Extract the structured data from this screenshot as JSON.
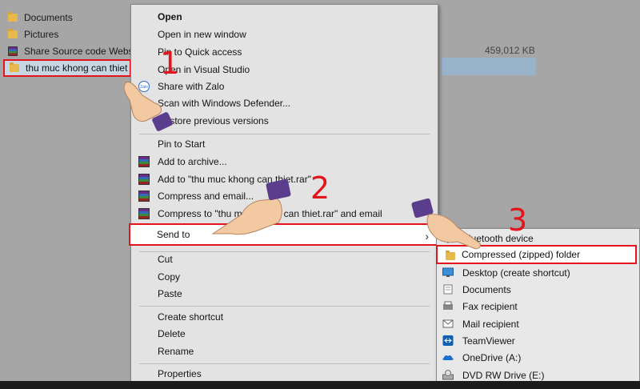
{
  "explorer": {
    "items": [
      {
        "name": "Documents",
        "icon": "folder-icon"
      },
      {
        "name": "Pictures",
        "icon": "folder-icon"
      },
      {
        "name": "Share Source code Websit",
        "icon": "rar-archive-icon"
      }
    ],
    "selected_item": "thu muc khong can thiet",
    "size_label": "459,012 KB"
  },
  "context_menu": {
    "open": "Open",
    "open_new_window": "Open in new window",
    "pin_quick_access": "Pin to Quick access",
    "open_visual_studio": "Open in Visual Studio",
    "share_zalo": "Share with Zalo",
    "scan_defender": "Scan with Windows Defender...",
    "restore_versions": "Restore previous versions",
    "pin_start": "Pin to Start",
    "add_archive": "Add to archive...",
    "add_to_rar": "Add to \"thu muc khong can thiet.rar\"",
    "compress_email": "Compress and email...",
    "compress_to_rar_email": "Compress to \"thu muc khong can thiet.rar\" and email",
    "send_to": "Send to",
    "cut": "Cut",
    "copy": "Copy",
    "paste": "Paste",
    "create_shortcut": "Create shortcut",
    "delete": "Delete",
    "rename": "Rename",
    "properties": "Properties"
  },
  "send_to_menu": {
    "bluetooth": "Bluetooth device",
    "zip": "Compressed (zipped) folder",
    "desktop": "Desktop (create shortcut)",
    "documents": "Documents",
    "fax": "Fax recipient",
    "mail": "Mail recipient",
    "teamviewer": "TeamViewer",
    "onedrive": "OneDrive (A:)",
    "dvd": "DVD RW Drive (E:)"
  },
  "annotations": {
    "step1": "1",
    "step2": "2",
    "step3": "3"
  },
  "colors": {
    "highlight_red": "#e3141b",
    "folder_yellow": "#e7b94a"
  }
}
